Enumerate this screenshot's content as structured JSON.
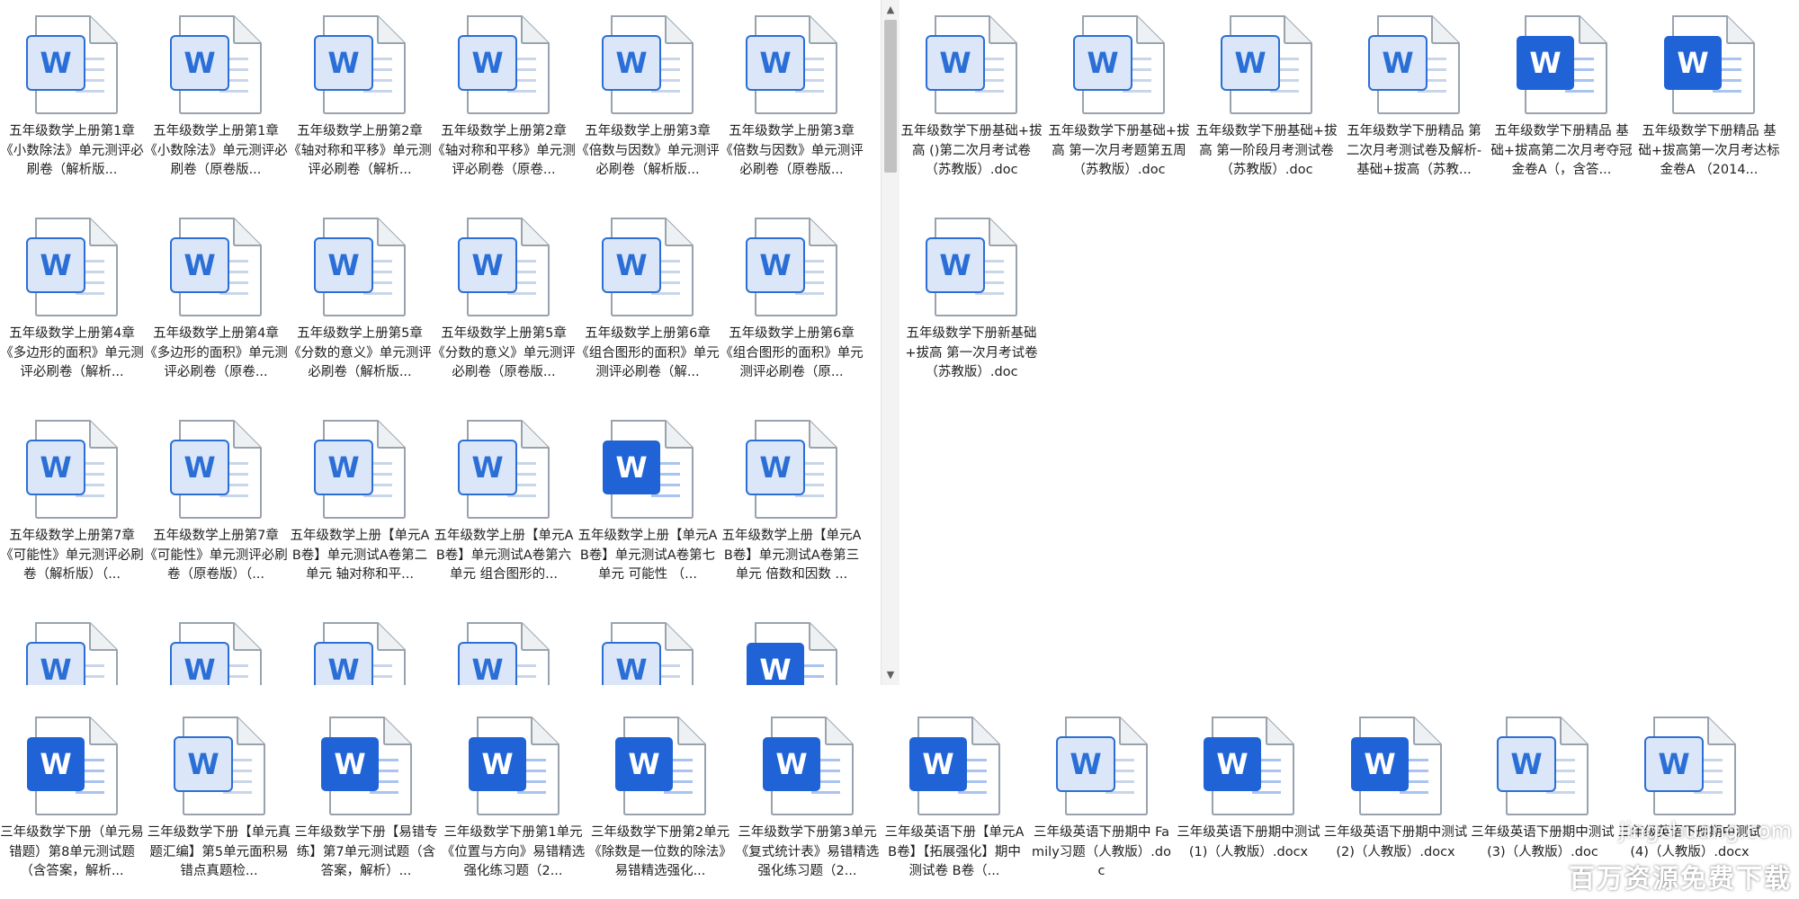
{
  "left_pane": {
    "files": [
      {
        "name": "五年级数学上册第1章《小数除法》单元测评必刷卷（解析版...",
        "style": "light"
      },
      {
        "name": "五年级数学上册第1章《小数除法》单元测评必刷卷（原卷版...",
        "style": "light"
      },
      {
        "name": "五年级数学上册第2章《轴对称和平移》单元测评必刷卷（解析...",
        "style": "light"
      },
      {
        "name": "五年级数学上册第2章《轴对称和平移》单元测评必刷卷（原卷...",
        "style": "light"
      },
      {
        "name": "五年级数学上册第3章《倍数与因数》单元测评必刷卷（解析版...",
        "style": "light"
      },
      {
        "name": "五年级数学上册第3章《倍数与因数》单元测评必刷卷（原卷版...",
        "style": "light"
      },
      {
        "name": "五年级数学上册第4章《多边形的面积》单元测评必刷卷（解析...",
        "style": "light"
      },
      {
        "name": "五年级数学上册第4章《多边形的面积》单元测评必刷卷（原卷...",
        "style": "light"
      },
      {
        "name": "五年级数学上册第5章《分数的意义》单元测评必刷卷（解析版...",
        "style": "light"
      },
      {
        "name": "五年级数学上册第5章《分数的意义》单元测评必刷卷（原卷版...",
        "style": "light"
      },
      {
        "name": "五年级数学上册第6章《组合图形的面积》单元测评必刷卷（解...",
        "style": "light"
      },
      {
        "name": "五年级数学上册第6章《组合图形的面积》单元测评必刷卷（原...",
        "style": "light"
      },
      {
        "name": "五年级数学上册第7章《可能性》单元测评必刷卷（解析版）（...",
        "style": "light"
      },
      {
        "name": "五年级数学上册第7章《可能性》单元测评必刷卷（原卷版）（...",
        "style": "light"
      },
      {
        "name": "五年级数学上册【单元AB卷】单元测试A卷第二单元 轴对称和平...",
        "style": "light"
      },
      {
        "name": "五年级数学上册【单元AB卷】单元测试A卷第六单元 组合图形的...",
        "style": "light"
      },
      {
        "name": "五年级数学上册【单元AB卷】单元测试A卷第七单元 可能性 （...",
        "style": "dark"
      },
      {
        "name": "五年级数学上册【单元AB卷】单元测试A卷第三单元 倍数和因数 ...",
        "style": "light"
      },
      {
        "name": "",
        "style": "light"
      },
      {
        "name": "",
        "style": "light"
      },
      {
        "name": "",
        "style": "light"
      },
      {
        "name": "",
        "style": "light"
      },
      {
        "name": "",
        "style": "light"
      },
      {
        "name": "",
        "style": "dark"
      }
    ]
  },
  "right_pane": {
    "files": [
      {
        "name": "五年级数学下册基础+拔高 ()第二次月考试卷（苏教版）.doc",
        "style": "light"
      },
      {
        "name": "五年级数学下册基础+拔高 第一次月考题第五周（苏教版）.doc",
        "style": "light"
      },
      {
        "name": "五年级数学下册基础+拔高 第一阶段月考测试卷（苏教版）.doc",
        "style": "light"
      },
      {
        "name": "五年级数学下册精品 第二次月考测试卷及解析-基础+拔高（苏教...",
        "style": "light"
      },
      {
        "name": "五年级数学下册精品 基础+拔高第二次月考夺冠金卷A（，含答...",
        "style": "dark"
      },
      {
        "name": "五年级数学下册精品 基础+拔高第一次月考达标金卷A （2014...",
        "style": "dark"
      },
      {
        "name": "五年级数学下册新基础+拔高 第一次月考试卷（苏教版）.doc",
        "style": "light"
      }
    ]
  },
  "bottom_pane": {
    "files": [
      {
        "name": "三年级数学下册（单元易错题）第8单元测试题（含答案，解析...",
        "style": "dark"
      },
      {
        "name": "三年级数学下册【单元真题汇编】第5单元面积易错点真题检...",
        "style": "light"
      },
      {
        "name": "三年级数学下册【易错专练】第7单元测试题（含答案，解析）...",
        "style": "dark"
      },
      {
        "name": "三年级数学下册第1单元《位置与方向》易错精选强化练习题（2...",
        "style": "dark"
      },
      {
        "name": "三年级数学下册第2单元《除数是一位数的除法》易错精选强化...",
        "style": "dark"
      },
      {
        "name": "三年级数学下册第3单元《复式统计表》易错精选强化练习题（2...",
        "style": "dark"
      },
      {
        "name": "三年级英语下册【单元AB卷】【拓展强化】期中测试卷 B卷（...",
        "style": "dark"
      },
      {
        "name": "三年级英语下册期中 Family习题（人教版）.doc",
        "style": "light"
      },
      {
        "name": "三年级英语下册期中测试 (1)（人教版）.docx",
        "style": "dark"
      },
      {
        "name": "三年级英语下册期中测试 (2)（人教版）.docx",
        "style": "dark"
      },
      {
        "name": "三年级英语下册期中测试 (3)（人教版）.doc",
        "style": "light"
      },
      {
        "name": "三年级英语下册期中测试 (4)（人教版）.docx",
        "style": "light"
      }
    ]
  },
  "watermark": {
    "url": "Jingchuang.com",
    "text": "百万资源免费下载"
  },
  "scrollbar": {
    "up": "▲",
    "down": "▼"
  },
  "icon_letter": "W",
  "colors": {
    "word_light_fill": "#dde8f8",
    "word_blue": "#2b6fd6",
    "word_dark": "#1f5fd4"
  }
}
